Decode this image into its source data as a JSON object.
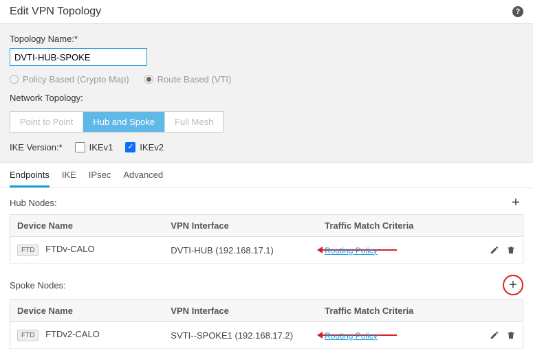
{
  "dialog": {
    "title": "Edit VPN Topology"
  },
  "form": {
    "topo_name_label": "Topology Name:*",
    "topo_name_value": "DVTI-HUB-SPOKE",
    "policy_based_label": "Policy Based (Crypto Map)",
    "route_based_label": "Route Based (VTI)",
    "net_topo_label": "Network Topology:",
    "topo_options": {
      "p2p": "Point to Point",
      "hub": "Hub and Spoke",
      "mesh": "Full Mesh"
    },
    "ike_version_label": "IKE Version:*",
    "ikev1_label": "IKEv1",
    "ikev2_label": "IKEv2"
  },
  "tabs": {
    "endpoints": "Endpoints",
    "ike": "IKE",
    "ipsec": "IPsec",
    "advanced": "Advanced"
  },
  "hub": {
    "title": "Hub Nodes:",
    "columns": {
      "dev": "Device Name",
      "vpn": "VPN Interface",
      "tmc": "Traffic Match Criteria"
    },
    "rows": [
      {
        "badge": "FTD",
        "name": "FTDv-CALO",
        "vpn": "DVTI-HUB (192.168.17.1)",
        "tmc": "Routing Policy"
      }
    ]
  },
  "spoke": {
    "title": "Spoke Nodes:",
    "columns": {
      "dev": "Device Name",
      "vpn": "VPN Interface",
      "tmc": "Traffic Match Criteria"
    },
    "rows": [
      {
        "badge": "FTD",
        "name": "FTDv2-CALO",
        "vpn": "SVTI--SPOKE1 (192.168.17.2)",
        "tmc": "Routing Policy"
      }
    ]
  }
}
